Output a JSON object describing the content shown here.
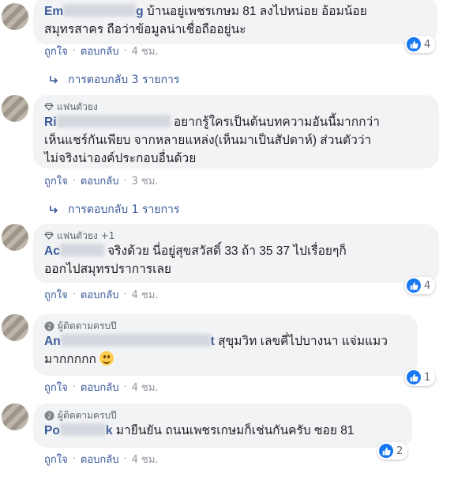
{
  "comments": [
    {
      "badge": "",
      "name_visible": "Em",
      "name_tail": "g",
      "text_line1": "บ้านอยู่เพชรเกษม 81 ลงไปหน่อย อ้อมน้อย",
      "text_line2": "สมุทรสาคร ถือว่าข้อมูลน่าเชื่อถืออยู่นะ",
      "like_label": "ถูกใจ",
      "reply_label": "ตอบกลับ",
      "time": "4 ชม.",
      "reaction_count": "4",
      "replies_label": "การตอบกลับ 3 รายการ"
    },
    {
      "badge": "แฟนตัวยง",
      "name_visible": "Ri",
      "text_line1": "อยากรู้ใครเป็นต้นบทความอันนี้มากกว่า",
      "text_line2": "เห็นแชร์กันเพียบ จากหลายแหล่ง(เห็นมาเป็นสัปดาห์) ส่วนตัวว่า",
      "text_line3": "ไม่จริงน่าองค์ประกอบอื่นด้วย",
      "like_label": "ถูกใจ",
      "reply_label": "ตอบกลับ",
      "time": "3 ชม.",
      "replies_label": "การตอบกลับ 1 รายการ"
    },
    {
      "badge": "แฟนตัวยง +1",
      "name_visible": "Ac",
      "text_line1": "จริงด้วย นี่อยู่สุขสวัสดิ์ 33 ถ้า 35 37 ไปเรื่อยๆก็",
      "text_line2": "ออกไปสมุทรปราการเลย",
      "like_label": "ถูกใจ",
      "reply_label": "ตอบกลับ",
      "time": "4 ชม.",
      "reaction_count": "4"
    },
    {
      "badge": "ผู้ติดตามครบปี",
      "name_visible": "An",
      "name_tail": "t",
      "text_line1": "สุขุมวิท เลขคี่ไปบางนา แจ่มแมว",
      "text_line2": "มากกกกก",
      "like_label": "ถูกใจ",
      "reply_label": "ตอบกลับ",
      "time": "4 ชม.",
      "reaction_count": "1"
    },
    {
      "badge": "ผู้ติดตามครบปี",
      "name_visible": "Po",
      "name_tail": "k",
      "text_line1": "มายืนยัน ถนนเพชรเกษมก็เช่นกันครับ ซอย 81",
      "like_label": "ถูกใจ",
      "reply_label": "ตอบกลับ",
      "time": "4 ชม.",
      "reaction_count": "2"
    }
  ],
  "separator": "·",
  "icons": {
    "like": "thumbs-up-icon",
    "diamond": "diamond-icon",
    "follower": "follower-badge-icon",
    "reply_arrow": "reply-arrow-icon",
    "emoji": "smiling-face-emoji"
  },
  "colors": {
    "link": "#385898",
    "bubble": "#f2f3f5",
    "like": "#1877f2"
  }
}
